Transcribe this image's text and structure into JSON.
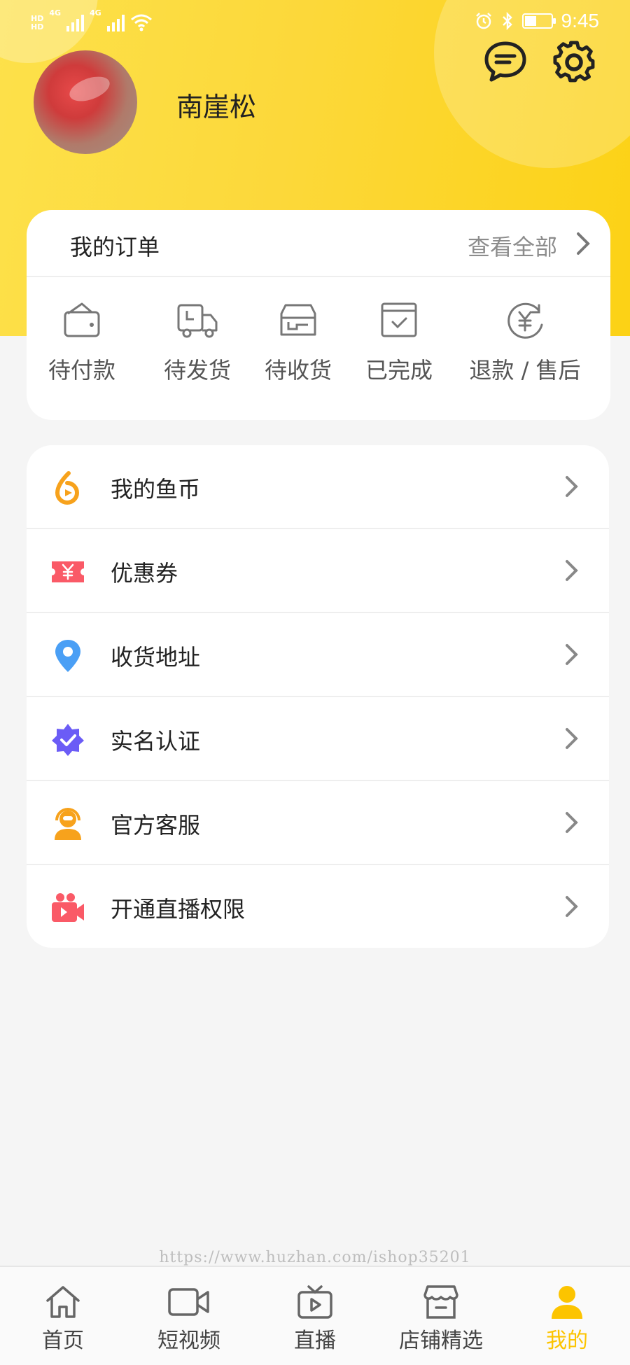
{
  "status_bar": {
    "network_left": "HD",
    "network_type": "4G",
    "time": "9:45"
  },
  "profile": {
    "username": "南崖松"
  },
  "icons": {
    "message": "message-icon",
    "settings": "gear-icon"
  },
  "orders": {
    "title": "我的订单",
    "view_all": "查看全部",
    "items": [
      {
        "label": "待付款",
        "icon": "wallet-icon"
      },
      {
        "label": "待发货",
        "icon": "truck-icon"
      },
      {
        "label": "待收货",
        "icon": "package-icon"
      },
      {
        "label": "已完成",
        "icon": "completed-icon"
      },
      {
        "label": "退款 / 售后",
        "icon": "refund-icon"
      }
    ]
  },
  "menu": {
    "items": [
      {
        "label": "我的鱼币",
        "icon": "fish-coin-icon"
      },
      {
        "label": "优惠券",
        "icon": "coupon-icon"
      },
      {
        "label": "收货地址",
        "icon": "location-icon"
      },
      {
        "label": "实名认证",
        "icon": "verified-icon"
      },
      {
        "label": "官方客服",
        "icon": "customer-service-icon"
      },
      {
        "label": "开通直播权限",
        "icon": "live-camera-icon"
      }
    ]
  },
  "watermark": "https://www.huzhan.com/ishop35201",
  "tabbar": {
    "items": [
      {
        "label": "首页",
        "icon": "home-icon"
      },
      {
        "label": "短视频",
        "icon": "video-icon"
      },
      {
        "label": "直播",
        "icon": "live-tv-icon"
      },
      {
        "label": "店铺精选",
        "icon": "store-icon"
      },
      {
        "label": "我的",
        "icon": "profile-icon"
      }
    ],
    "active": "我的"
  },
  "colors": {
    "header_gradient_start": "#fde14a",
    "header_gradient_end": "#fcd215",
    "tab_active": "#fcc400",
    "page_background": "#f5f5f5"
  }
}
